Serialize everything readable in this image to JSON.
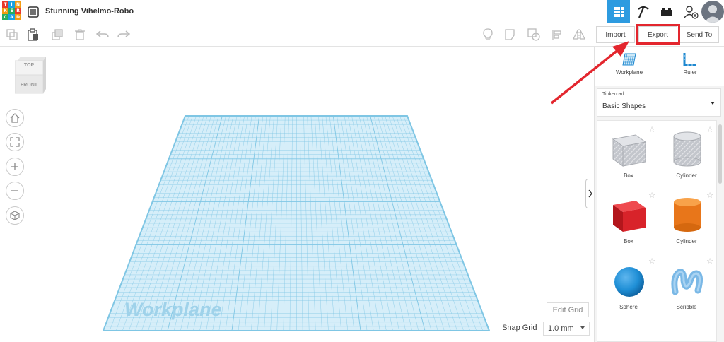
{
  "header": {
    "logo_letters": [
      "T",
      "I",
      "N",
      "K",
      "E",
      "R",
      "C",
      "A",
      "D"
    ],
    "project_title": "Stunning Vihelmo-Robo",
    "accent_color": "#2d9be0"
  },
  "toolbar": {
    "import_label": "Import",
    "export_label": "Export",
    "sendto_label": "Send To",
    "highlight_color": "#e3262e"
  },
  "viewcube": {
    "top_label": "TOP",
    "front_label": "FRONT"
  },
  "workplane": {
    "label": "Workplane",
    "grid_color": "#7fc6e4"
  },
  "bottom_controls": {
    "edit_grid_label": "Edit Grid",
    "snap_grid_label": "Snap Grid",
    "snap_value": "1.0 mm"
  },
  "panel": {
    "workplane_label": "Workplane",
    "ruler_label": "Ruler",
    "library_small": "Tinkercad",
    "library_main": "Basic Shapes",
    "shapes": [
      {
        "label": "Box",
        "color": "#b9bcc3"
      },
      {
        "label": "Cylinder",
        "color": "#b9bcc3"
      },
      {
        "label": "Box",
        "color": "#d8232a"
      },
      {
        "label": "Cylinder",
        "color": "#f0801e"
      },
      {
        "label": "Sphere",
        "color": "#1f8fd6"
      },
      {
        "label": "Scribble",
        "color": "#7ab8e6"
      }
    ]
  }
}
